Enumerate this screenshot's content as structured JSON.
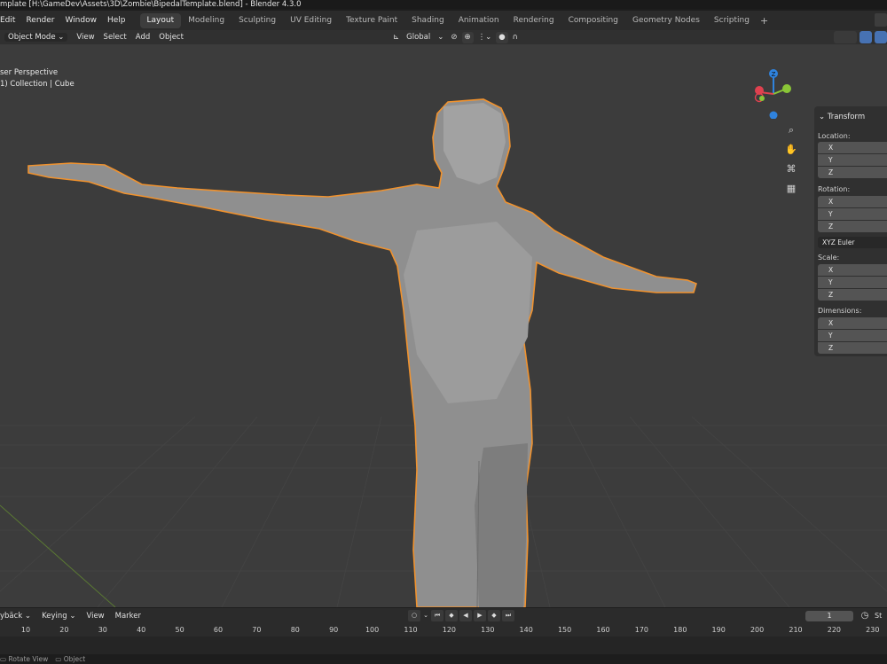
{
  "window": {
    "title": "mplate [H:\\GameDev\\Assets\\3D\\Zombie\\BipedalTemplate.blend] - Blender 4.3.0"
  },
  "menu": [
    "Edit",
    "Render",
    "Window",
    "Help"
  ],
  "workspaces": [
    "Layout",
    "Modeling",
    "Sculpting",
    "UV Editing",
    "Texture Paint",
    "Shading",
    "Animation",
    "Rendering",
    "Compositing",
    "Geometry Nodes",
    "Scripting"
  ],
  "workspace_add": "+",
  "header": {
    "mode": "Object Mode",
    "view": "View",
    "select": "Select",
    "add": "Add",
    "object": "Object",
    "transform_orientation": "Global"
  },
  "viewport": {
    "perspective": "ser Perspective",
    "collection": "1) Collection | Cube"
  },
  "gizmo": {
    "z": "Z"
  },
  "npanel": {
    "title": "Transform",
    "location": "Location:",
    "rotation": "Rotation:",
    "rotation_mode": "XYZ Euler",
    "scale": "Scale:",
    "dimensions": "Dimensions:",
    "x": "X",
    "y": "Y",
    "z": "Z"
  },
  "timeline": {
    "playback": "ybäck",
    "keying": "Keying",
    "view": "View",
    "marker": "Marker",
    "current_frame": "1",
    "start_label": "St",
    "ticks": [
      "10",
      "20",
      "30",
      "40",
      "50",
      "60",
      "70",
      "80",
      "90",
      "100",
      "110",
      "120",
      "130",
      "140",
      "150",
      "160",
      "170",
      "180",
      "190",
      "200",
      "210",
      "220",
      "230"
    ]
  },
  "status": {
    "rotate": "Rotate View",
    "object": "Object"
  },
  "colors": {
    "selection_outline": "#f0922e",
    "active_tab": "#3d3d3d",
    "viewport_bg": "#3c3c3c",
    "axis_x": "#e0414f",
    "axis_y": "#8ac637",
    "axis_z": "#2f83de"
  }
}
